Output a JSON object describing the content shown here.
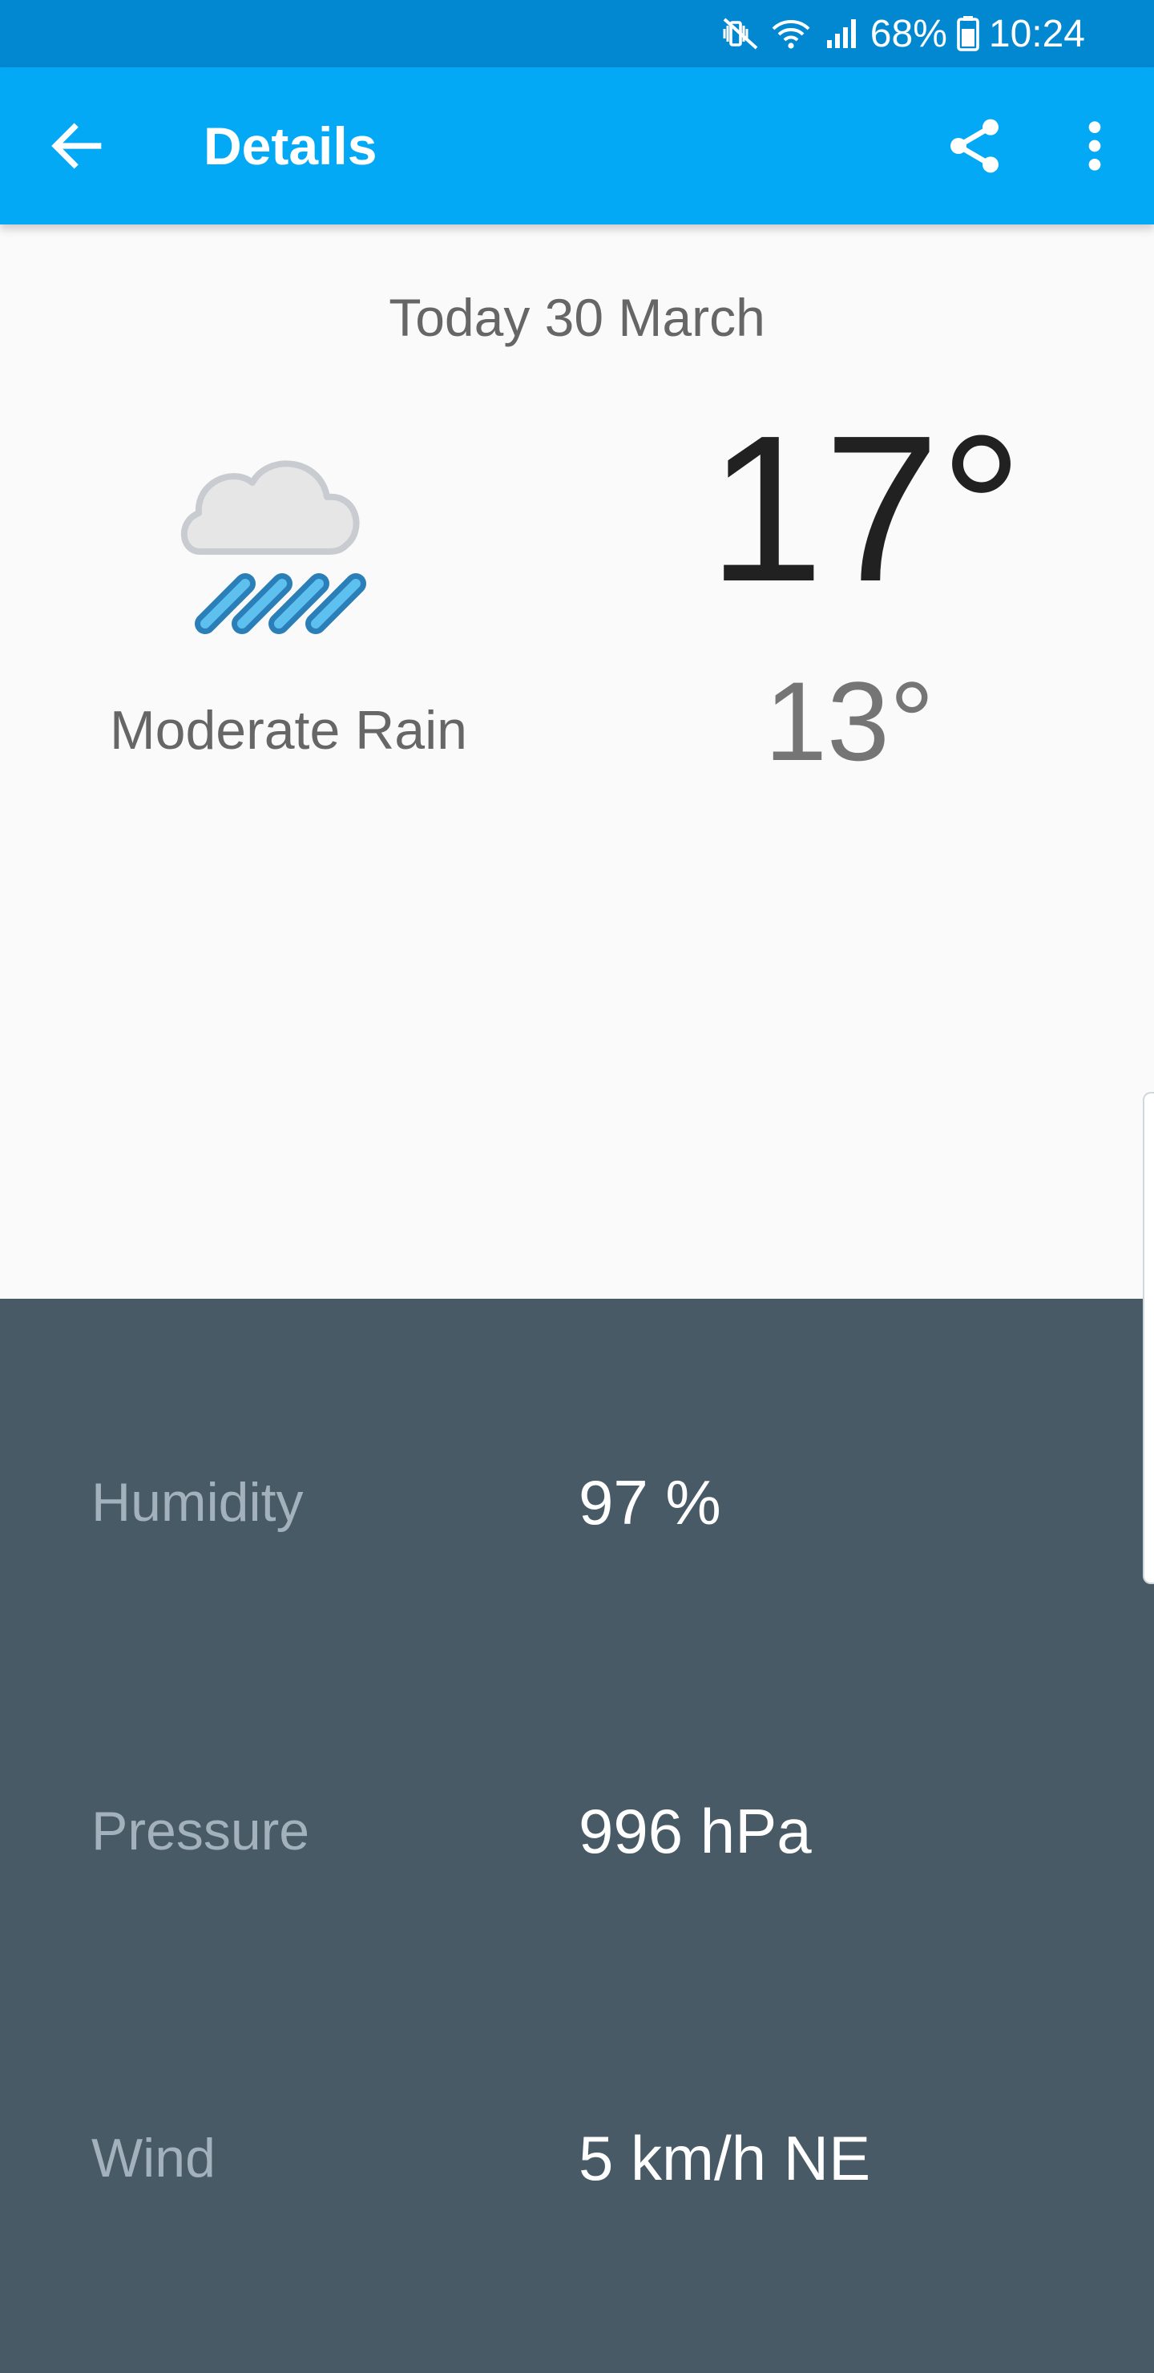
{
  "status_bar": {
    "battery": "68%",
    "time": "10:24",
    "icons": [
      "mute-vibrate-icon",
      "wifi-icon",
      "signal-icon",
      "battery-icon"
    ]
  },
  "app_bar": {
    "title": "Details",
    "icons": [
      "back-arrow-icon",
      "share-icon",
      "more-vert-icon"
    ],
    "color": "#03a9f4",
    "dark_color": "#0288d1"
  },
  "summary": {
    "date": "Today 30 March",
    "condition": "Moderate Rain",
    "condition_icon": "rain-cloud-icon",
    "high_temp": "17°",
    "low_temp": "13°"
  },
  "details": [
    {
      "label": "Humidity",
      "value": "97 %"
    },
    {
      "label": "Pressure",
      "value": "996 hPa"
    },
    {
      "label": "Wind",
      "value": "5 km/h NE"
    }
  ],
  "colors": {
    "panel_bg": "#485a66",
    "label": "#a3b1bc",
    "value": "#ffffff"
  }
}
